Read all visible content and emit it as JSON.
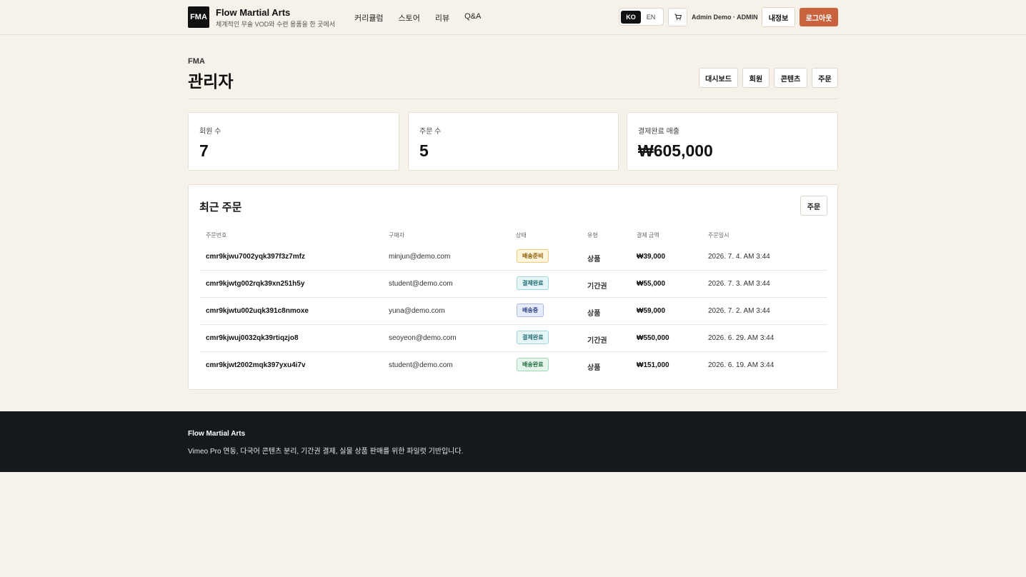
{
  "header": {
    "logo": "FMA",
    "brand_title": "Flow Martial Arts",
    "brand_subtitle": "체계적인 무술 VOD와 수련 용품을 한 곳에서",
    "nav": [
      "커리큘럼",
      "스토어",
      "리뷰",
      "Q&A"
    ],
    "lang_active": "KO",
    "lang_other": "EN",
    "user_label": "Admin Demo · ADMIN",
    "profile_button": "내정보",
    "logout_button": "로그아웃"
  },
  "page": {
    "eyebrow": "FMA",
    "title": "관리자",
    "admin_nav": [
      "대시보드",
      "회원",
      "콘텐츠",
      "주문"
    ]
  },
  "stats": [
    {
      "label": "회원 수",
      "value": "7"
    },
    {
      "label": "주문 수",
      "value": "5"
    },
    {
      "label": "결제완료 매출",
      "value": "₩605,000"
    }
  ],
  "orders": {
    "title": "최근 주문",
    "button": "주문",
    "columns": [
      "주문번호",
      "구매자",
      "상태",
      "유형",
      "결제 금액",
      "주문일시"
    ],
    "rows": [
      {
        "id": "cmr9kjwu7002yqk397f3z7mfz",
        "buyer": "minjun@demo.com",
        "status": "배송준비",
        "type": "상품",
        "amount": "₩39,000",
        "date": "2026. 7. 4. AM 3:44"
      },
      {
        "id": "cmr9kjwtg002rqk39xn251h5y",
        "buyer": "student@demo.com",
        "status": "결제완료",
        "type": "기간권",
        "amount": "₩55,000",
        "date": "2026. 7. 3. AM 3:44"
      },
      {
        "id": "cmr9kjwtu002uqk391c8nmoxe",
        "buyer": "yuna@demo.com",
        "status": "배송중",
        "type": "상품",
        "amount": "₩59,000",
        "date": "2026. 7. 2. AM 3:44"
      },
      {
        "id": "cmr9kjwuj0032qk39rtiqzjo8",
        "buyer": "seoyeon@demo.com",
        "status": "결제완료",
        "type": "기간권",
        "amount": "₩550,000",
        "date": "2026. 6. 29. AM 3:44"
      },
      {
        "id": "cmr9kjwt2002mqk397yxu4i7v",
        "buyer": "student@demo.com",
        "status": "배송완료",
        "type": "상품",
        "amount": "₩151,000",
        "date": "2026. 6. 19. AM 3:44"
      }
    ]
  },
  "footer": {
    "title": "Flow Martial Arts",
    "description": "Vimeo Pro 연동, 다국어 콘텐츠 분리, 기간권 결제, 실물 상품 판매를 위한 파일럿 기반입니다."
  },
  "icons": {
    "cart": "cart-icon"
  }
}
